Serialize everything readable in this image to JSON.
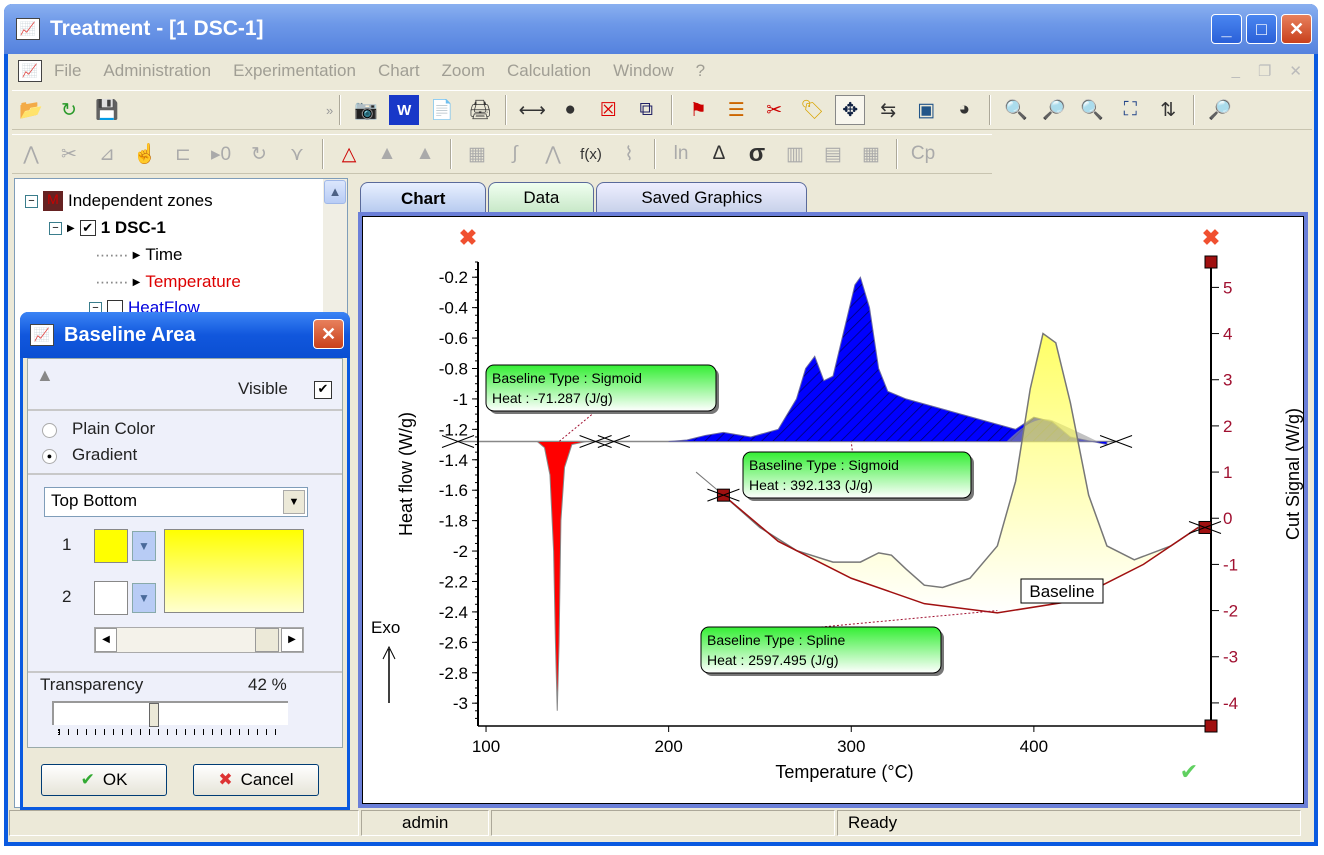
{
  "window": {
    "title": "Treatment - [1 DSC-1]",
    "controls": [
      "minimize",
      "maximize",
      "close"
    ]
  },
  "menu": [
    "File",
    "Administration",
    "Experimentation",
    "Chart",
    "Zoom",
    "Calculation",
    "Window",
    "?"
  ],
  "toolbar1": {
    "overflow": "»",
    "icons": [
      "open-folder",
      "reload",
      "save",
      "camera",
      "word-export",
      "pdf-export",
      "print",
      "fit-width",
      "circle-marker",
      "delete-cross",
      "copy-layers",
      "flag-marker",
      "list",
      "cut-x",
      "tag",
      "move-cross",
      "align",
      "window-add",
      "sphere",
      "zoom-search",
      "zoom-in",
      "zoom-out",
      "fit-frame",
      "axis-swap",
      "magnifier-window"
    ]
  },
  "toolbar2": {
    "icons": [
      "peak",
      "scissors",
      "slope",
      "hand-point",
      "step",
      "zero",
      "rotate",
      "derivative",
      "baseline-peak",
      "area-fill",
      "area-fill-2",
      "grid-hatch",
      "integral",
      "peaks",
      "fx",
      "signal",
      "ln",
      "delta",
      "sigma",
      "histogram",
      "bar-chart",
      "grid",
      "cp"
    ],
    "text_icons": {
      "fx": "f(x)",
      "ln": "ln",
      "delta": "Δ",
      "sigma": "σ",
      "cp": "Cp"
    }
  },
  "tree": {
    "root": "Independent zones",
    "child": "1 DSC-1",
    "items": [
      "Time",
      "Temperature",
      "HeatFlow"
    ]
  },
  "dialog": {
    "title": "Baseline Area",
    "visible_label": "Visible",
    "visible": true,
    "plain_label": "Plain Color",
    "gradient_label": "Gradient",
    "selected_fill": "Gradient",
    "direction": "Top Bottom",
    "color1_label": "1",
    "color2_label": "2",
    "color1": "#ffff00",
    "color2": "#ffffff",
    "transparency_label": "Transparency",
    "transparency_value": "42 %",
    "transparency": 42,
    "ok": "OK",
    "cancel": "Cancel"
  },
  "tabs": [
    "Chart",
    "Data",
    "Saved Graphics"
  ],
  "status": {
    "user": "admin",
    "state": "Ready"
  },
  "chart_data": {
    "type": "line",
    "xlabel": "Temperature (°C)",
    "ylabel": "Heat flow (W/g)",
    "y2label": "Cut Signal (W/g)",
    "xlim": [
      95.6,
      497
    ],
    "ylim": [
      -3.15,
      -0.1
    ],
    "y2lim": [
      -4.5,
      5.55
    ],
    "xticks": [
      100,
      200,
      300,
      400
    ],
    "yticks": [
      -0.2,
      -0.4,
      -0.6,
      -0.8,
      -1,
      -1.2,
      -1.4,
      -1.6,
      -1.8,
      -2,
      -2.2,
      -2.4,
      -2.6,
      -2.8,
      -3
    ],
    "y2ticks": [
      5,
      4,
      3,
      2,
      1,
      0,
      -1,
      -2,
      -3,
      -4
    ],
    "exo_label": "Exo",
    "series": [
      {
        "axis": "left",
        "color": "#ff0000",
        "x": [
          100,
          128,
          132,
          135,
          137,
          138,
          139,
          140,
          141,
          143,
          147,
          155,
          200
        ],
        "y": [
          -1.28,
          -1.28,
          -1.32,
          -1.5,
          -2.0,
          -2.6,
          -3.05,
          -2.6,
          -1.8,
          -1.45,
          -1.3,
          -1.28,
          -1.28
        ]
      },
      {
        "axis": "left",
        "color": "#0000ff",
        "x": [
          200,
          210,
          220,
          230,
          245,
          260,
          270,
          275,
          280,
          285,
          290,
          297,
          302,
          305,
          310,
          315,
          320,
          330,
          345,
          360,
          375,
          390,
          400,
          410,
          420,
          440
        ],
        "y": [
          -1.28,
          -1.27,
          -1.24,
          -1.22,
          -1.25,
          -1.2,
          -1.0,
          -0.8,
          -0.72,
          -0.88,
          -0.85,
          -0.5,
          -0.25,
          -0.2,
          -0.4,
          -0.8,
          -0.95,
          -1.0,
          -1.05,
          -1.1,
          -1.15,
          -1.2,
          -1.12,
          -1.15,
          -1.25,
          -1.3
        ]
      },
      {
        "axis": "right",
        "color": "#ffff00",
        "x": [
          230,
          250,
          270,
          290,
          305,
          315,
          322,
          330,
          340,
          350,
          365,
          380,
          390,
          398,
          405,
          412,
          420,
          430,
          440,
          455,
          475,
          490
        ],
        "y": [
          0.5,
          -0.2,
          -0.7,
          -0.95,
          -0.95,
          -0.75,
          -0.8,
          -1.1,
          -1.45,
          -1.5,
          -1.3,
          -0.6,
          0.8,
          2.8,
          4.0,
          3.8,
          2.5,
          0.5,
          -0.6,
          -0.9,
          -0.6,
          -0.2
        ]
      },
      {
        "axis": "right",
        "color": "#a01010",
        "name": "Baseline",
        "x": [
          230,
          260,
          300,
          340,
          380,
          420,
          460,
          490
        ],
        "y": [
          0.5,
          -0.5,
          -1.3,
          -1.85,
          -2.05,
          -1.8,
          -1.0,
          -0.2
        ]
      }
    ],
    "baseline_level": -1.28,
    "annotations": [
      {
        "type": "Sigmoid",
        "heat": "-71.287 (J/g)",
        "type_label": "Baseline Type :",
        "heat_label": "Heat"
      },
      {
        "type": "Sigmoid",
        "heat": "392.133 (J/g)",
        "type_label": "Baseline Type :",
        "heat_label": "Heat"
      },
      {
        "type": "Spline",
        "heat": "2597.495 (J/g)",
        "type_label": "Baseline Type :",
        "heat_label": "Heat"
      }
    ]
  }
}
